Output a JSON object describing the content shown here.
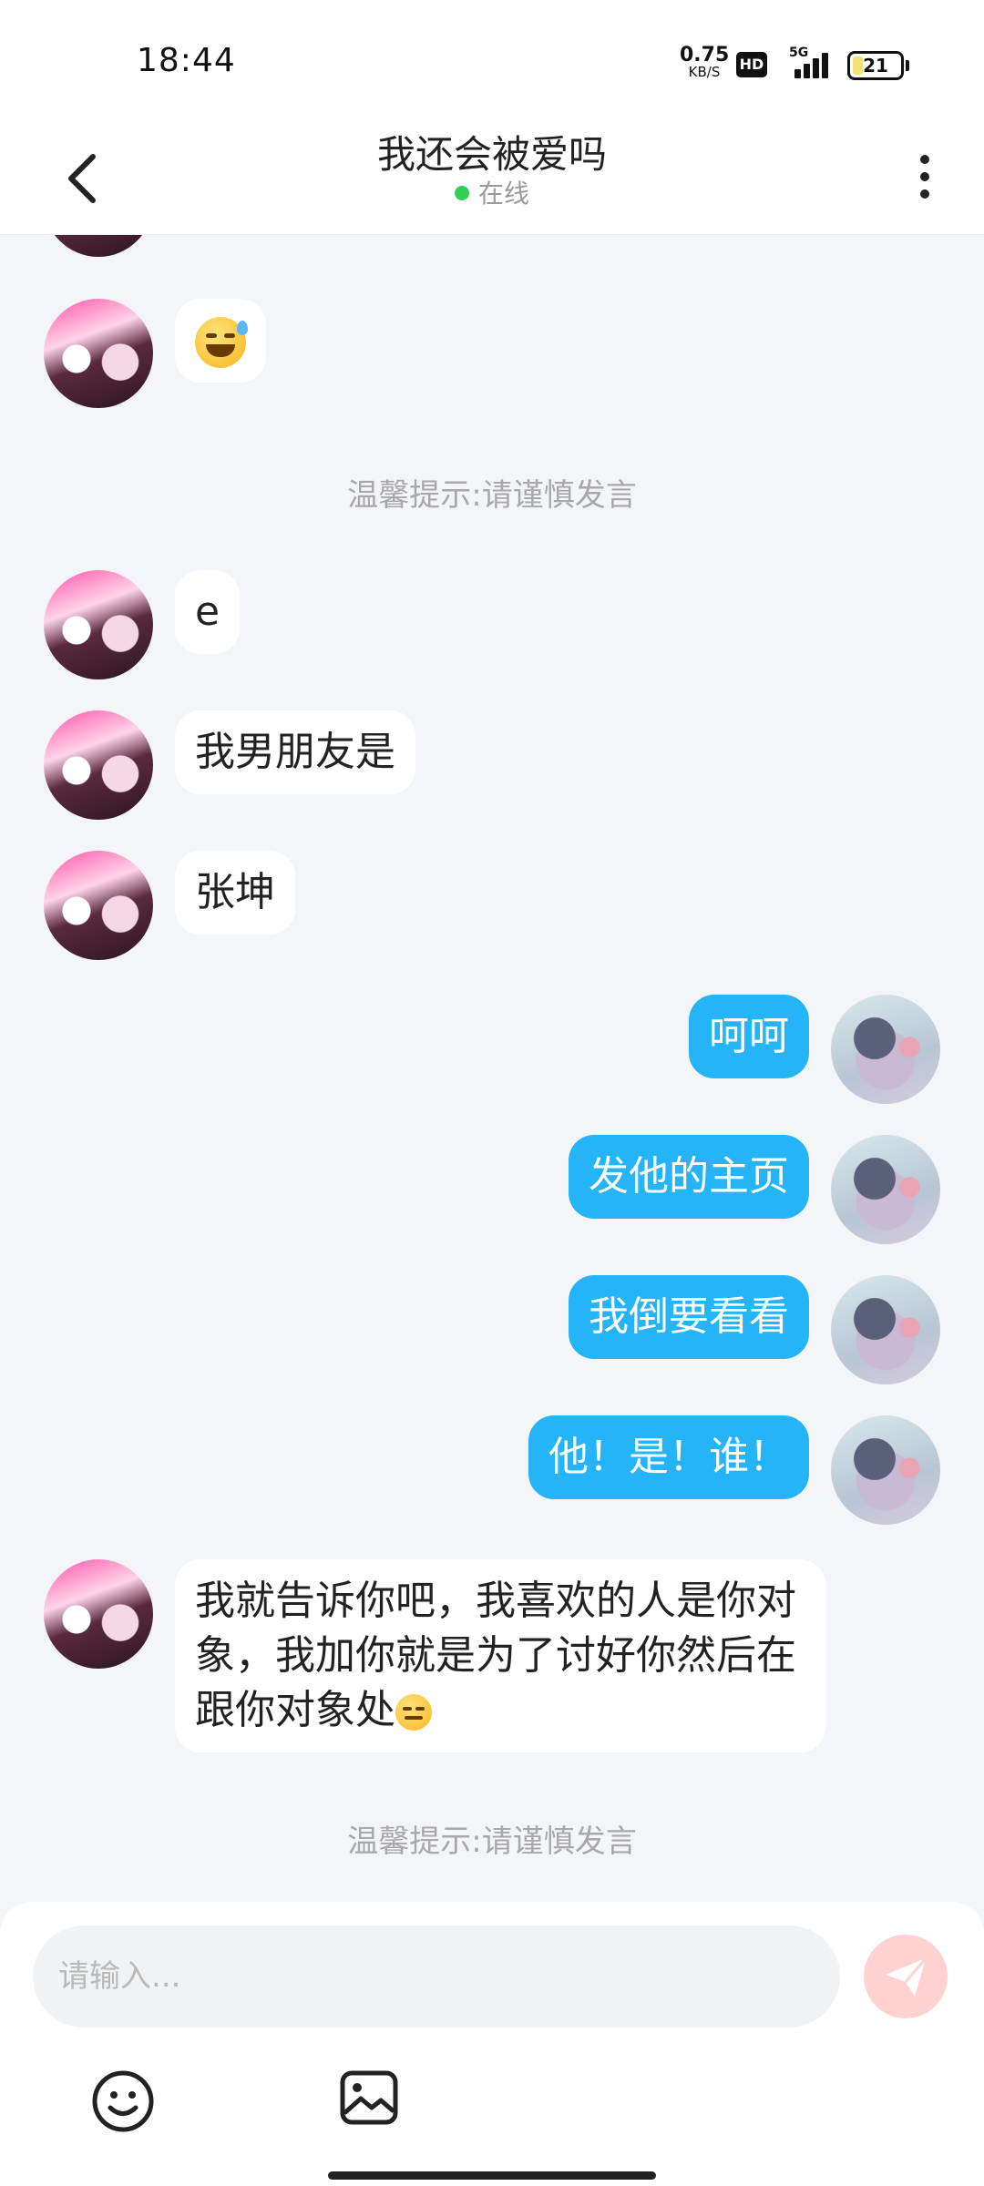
{
  "status_bar": {
    "time": "18:44",
    "net_speed_value": "0.75",
    "net_speed_unit": "KB/S",
    "hd_label": "HD",
    "network_type": "5G",
    "battery_level": "21"
  },
  "header": {
    "title": "我还会被爱吗",
    "status": "在线",
    "status_color": "#2fcf57"
  },
  "messages": [
    {
      "side": "in",
      "text": "e"
    },
    {
      "side": "in",
      "text": "我男朋友是"
    },
    {
      "side": "in",
      "text": "张坤"
    },
    {
      "side": "out",
      "text": "呵呵"
    },
    {
      "side": "out",
      "text": "发他的主页"
    },
    {
      "side": "out",
      "text": "我倒要看看"
    },
    {
      "side": "out",
      "text": "他！是！谁！"
    },
    {
      "side": "in",
      "text": "我就告诉你吧，我喜欢的人是你对象，我加你就是为了讨好你然后在跟你对象处"
    }
  ],
  "emojis": {
    "first_message": "grinning-sweat-emoji",
    "last_message_suffix": "expressionless-emoji"
  },
  "tips": {
    "tip_1": "温馨提示:请谨慎发言",
    "tip_2": "温馨提示:请谨慎发言"
  },
  "composer": {
    "placeholder": "请输入..."
  },
  "colors": {
    "outgoing_bubble": "#25b4f8",
    "incoming_bubble": "#ffffff",
    "background": "#f4f5f9",
    "send_button": "#ffd1d1"
  }
}
